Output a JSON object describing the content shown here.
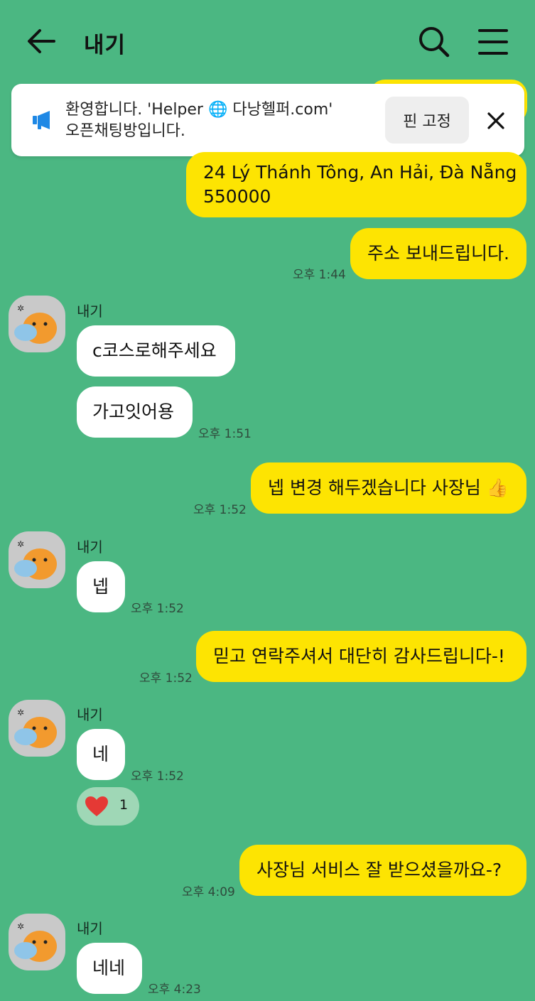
{
  "header": {
    "title": "내기"
  },
  "notice": {
    "line1": "환영합니다. 'Helper 🌐 다낭헬퍼.com'",
    "line2": "오픈채팅방입니다.",
    "pin_label": "핀 고정"
  },
  "messages": [
    {
      "id": "m1",
      "sender": "me",
      "text_line1": "24 Lý Thánh Tông, An Hải, Đà Nẵng",
      "text_line2": "550000"
    },
    {
      "id": "m2",
      "sender": "me",
      "text": "주소 보내드립니다.",
      "time": "오후 1:44"
    },
    {
      "id": "m3",
      "sender": "other",
      "name": "내기",
      "text": "c코스로해주세요"
    },
    {
      "id": "m4",
      "sender": "other",
      "text": "가고잇어용",
      "time": "오후 1:51"
    },
    {
      "id": "m5",
      "sender": "me",
      "text": "넵 변경 해두겠습니다 사장님 👍",
      "time": "오후 1:52"
    },
    {
      "id": "m6",
      "sender": "other",
      "name": "내기",
      "text": "넵",
      "time": "오후 1:52"
    },
    {
      "id": "m7",
      "sender": "me",
      "text": "믿고 연락주셔서 대단히 감사드립니다-!",
      "time": "오후 1:52"
    },
    {
      "id": "m8",
      "sender": "other",
      "name": "내기",
      "text": "네",
      "time": "오후 1:52"
    },
    {
      "id": "m9",
      "sender": "me",
      "text": "사장님 서비스 잘 받으셨을까요-?",
      "time": "오후 4:09"
    },
    {
      "id": "m10",
      "sender": "other",
      "name": "내기",
      "text": "네네",
      "time": "오후 4:23"
    }
  ],
  "reaction": {
    "emoji": "❤",
    "count": "1"
  },
  "colors": {
    "background": "#4bb782",
    "my_bubble": "#fde402",
    "other_bubble": "#ffffff",
    "notice_icon": "#1e88e5",
    "heart": "#e53935"
  },
  "icons": {
    "back": "arrow-left-icon",
    "search": "search-icon",
    "menu": "hamburger-menu-icon",
    "notice": "megaphone-icon",
    "close": "close-icon",
    "avatar": "character-avatar-icon"
  }
}
